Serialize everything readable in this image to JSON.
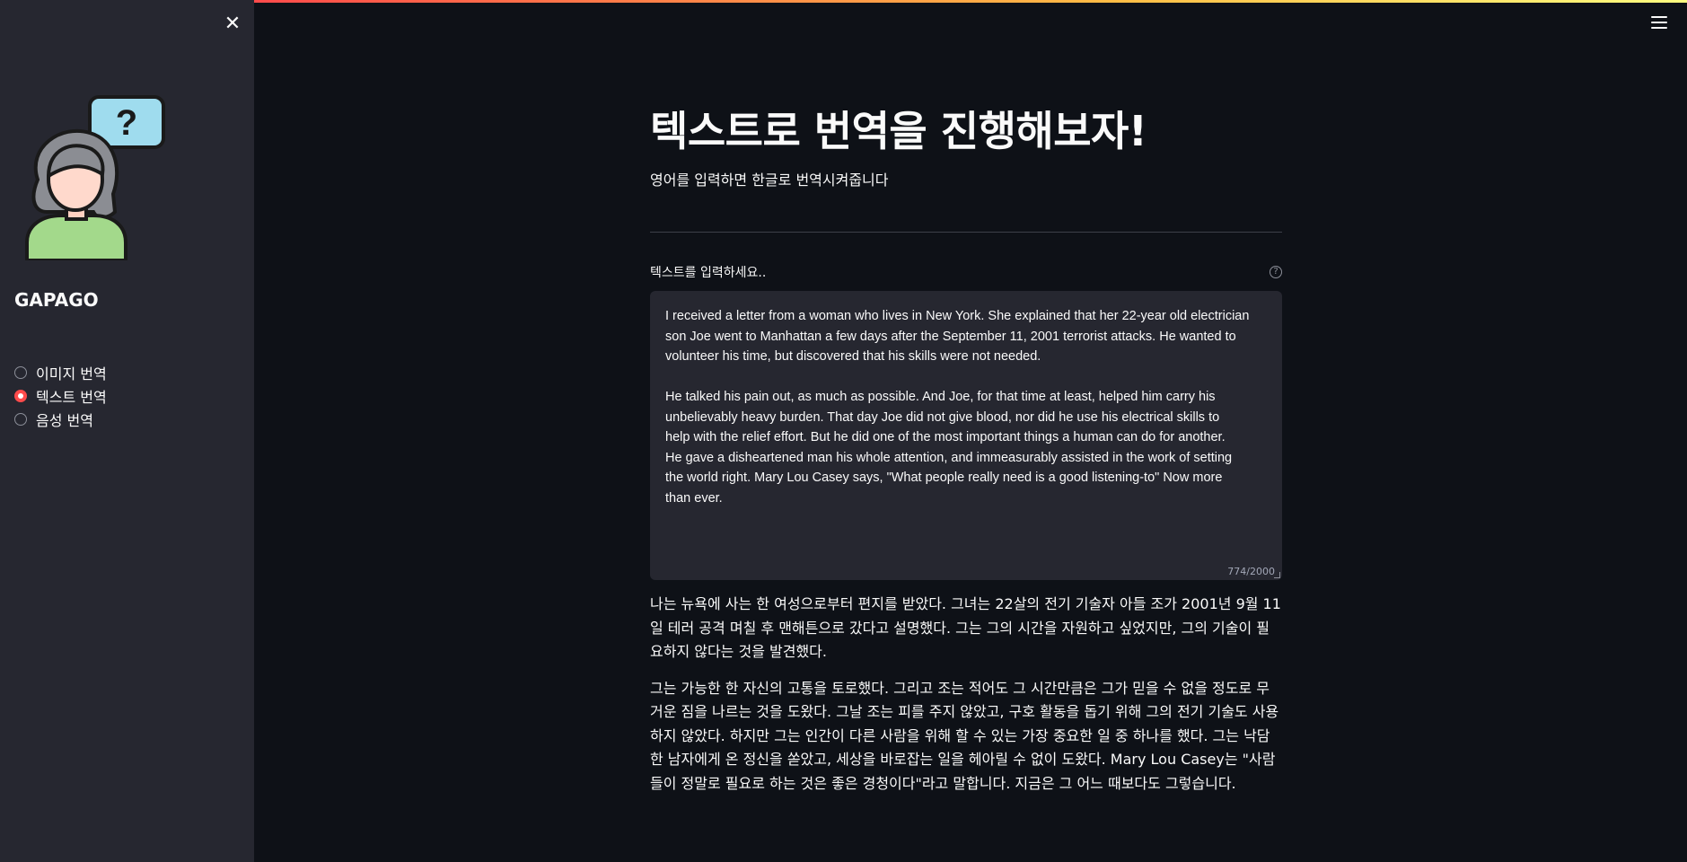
{
  "sidebar": {
    "brand": "GAPAGO",
    "close_icon": "close-icon",
    "logo_icon": "person-question-illustration",
    "options": [
      {
        "label": "이미지 번역",
        "selected": false
      },
      {
        "label": "텍스트 번역",
        "selected": true
      },
      {
        "label": "음성 번역",
        "selected": false
      }
    ]
  },
  "header": {
    "menu_icon": "hamburger-menu-icon"
  },
  "main": {
    "title": "텍스트로 번역을 진행해보자!",
    "subtitle": "영어를 입력하면 한글로 번역시켜줍니다",
    "input_label": "텍스트를 입력하세요..",
    "help_icon": "?",
    "input_value": "I received a letter from a woman who lives in New York. She explained that her 22-year old electrician\nson Joe went to Manhattan a few days after the September 11, 2001 terrorist attacks. He wanted to\nvolunteer his time, but discovered that his skills were not needed.\n\nHe talked his pain out, as much as possible. And Joe, for that time at least, helped him carry his\nunbelievably heavy burden. That day Joe did not give blood, nor did he use his electrical skills to\nhelp with the relief effort. But he did one of the most important things a human can do for another.\nHe gave a disheartened man his whole attention, and immeasurably assisted in the work of setting\nthe world right. Mary Lou Casey says, \"What people really need is a good listening-to\" Now more\nthan ever.",
    "char_count": "774/2000",
    "output_paragraphs": [
      "나는 뉴욕에 사는 한 여성으로부터 편지를 받았다. 그녀는 22살의 전기 기술자 아들 조가 2001년 9월 11일 테러 공격 며칠 후 맨해튼으로 갔다고 설명했다. 그는 그의 시간을 자원하고 싶었지만, 그의 기술이 필요하지 않다는 것을 발견했다.",
      "그는 가능한 한 자신의 고통을 토로했다. 그리고 조는 적어도 그 시간만큼은 그가 믿을 수 없을 정도로 무거운 짐을 나르는 것을 도왔다. 그날 조는 피를 주지 않았고, 구호 활동을 돕기 위해 그의 전기 기술도 사용하지 않았다. 하지만 그는 인간이 다른 사람을 위해 할 수 있는 가장 중요한 일 중 하나를 했다. 그는 낙담한 남자에게 온 정신을 쏟았고, 세상을 바로잡는 일을 헤아릴 수 없이 도왔다. Mary Lou Casey는 \"사람들이 정말로 필요로 하는 것은 좋은 경청이다\"라고 말합니다. 지금은 그 어느 때보다도 그렇습니다."
    ]
  },
  "colors": {
    "background": "#0e1117",
    "sidebar": "#262730",
    "accent": "#ff4b4b"
  }
}
